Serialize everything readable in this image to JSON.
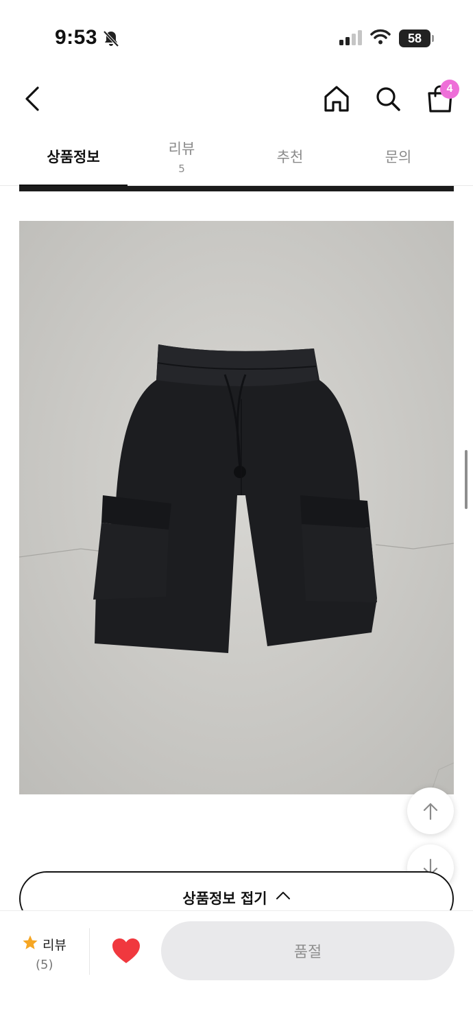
{
  "status_bar": {
    "time": "9:53",
    "battery": "58"
  },
  "header": {
    "cart_count": "4"
  },
  "tabs": [
    {
      "label": "상품정보",
      "count": "",
      "active": true
    },
    {
      "label": "리뷰",
      "count": "5",
      "active": false
    },
    {
      "label": "추천",
      "count": "",
      "active": false
    },
    {
      "label": "문의",
      "count": "",
      "active": false
    }
  ],
  "content": {
    "collapse_label": "상품정보 접기"
  },
  "bottom_bar": {
    "review_label": "리뷰",
    "review_count": "(5)",
    "purchase_label": "품절"
  },
  "colors": {
    "badge": "#ee6fd8",
    "heart": "#f0383e",
    "star": "#f6a623",
    "soldout_bg": "#e9e9eb"
  },
  "icons": [
    "bell-off-icon",
    "signal-icon",
    "wifi-icon",
    "battery-icon",
    "back-icon",
    "home-icon",
    "search-icon",
    "cart-icon",
    "arrow-up-icon",
    "arrow-down-icon",
    "chevron-up-icon",
    "star-icon",
    "heart-icon"
  ]
}
